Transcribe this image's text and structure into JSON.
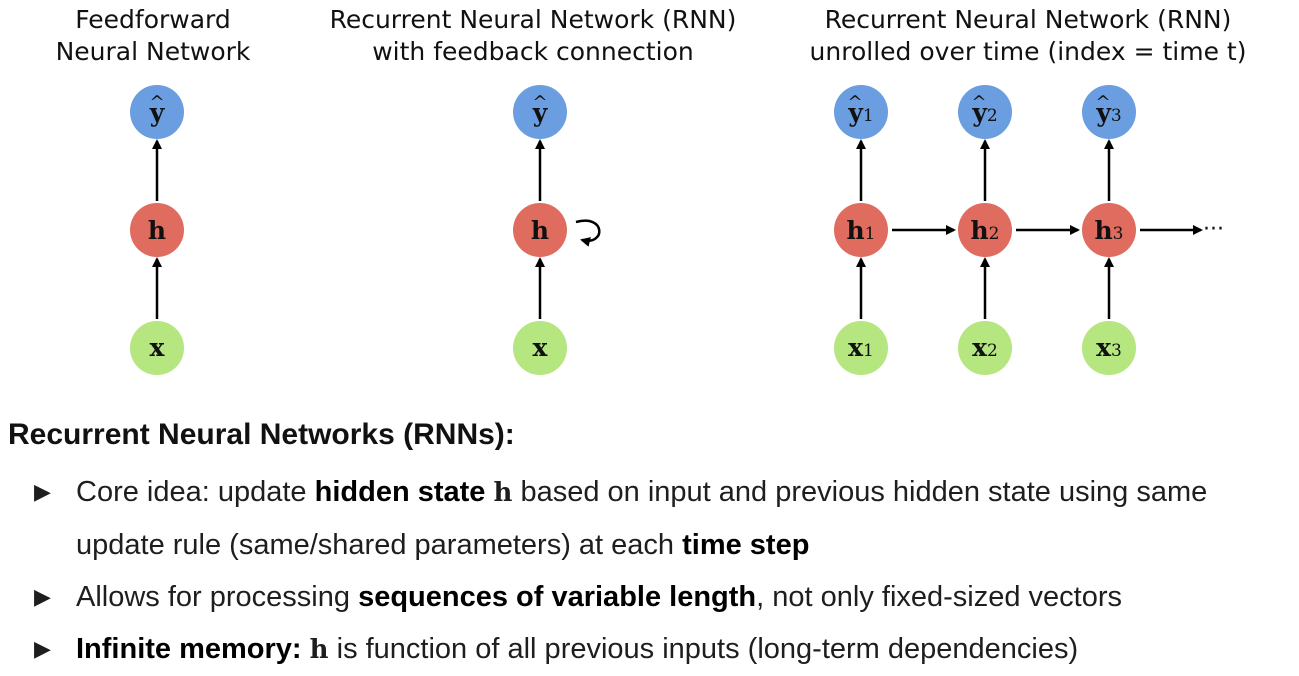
{
  "panels": [
    {
      "title_lines": [
        "Feedforward",
        "Neural Network"
      ]
    },
    {
      "title_lines": [
        "Recurrent Neural Network (RNN)",
        "with feedback connection"
      ]
    },
    {
      "title_lines": [
        "Recurrent Neural Network (RNN)",
        "unrolled over time (index = time t)"
      ]
    }
  ],
  "nodes": {
    "output": {
      "label": "y",
      "color": "#6a9ee0"
    },
    "hidden": {
      "label": "h",
      "color": "#e06c5f"
    },
    "input": {
      "label": "x",
      "color": "#b5e67f"
    }
  },
  "unrolled_indices": [
    "1",
    "2",
    "3"
  ],
  "continuation": "···",
  "section": {
    "heading": "Recurrent Neural Networks (RNNs):",
    "bullets": [
      {
        "parts": [
          {
            "text": "Core idea: update "
          },
          {
            "text": "hidden state",
            "bold": true
          },
          {
            "text": " "
          },
          {
            "text": "h",
            "math": true
          },
          {
            "text": " based on input and previous hidden state using same update rule (same/shared parameters) at each "
          },
          {
            "text": "time step",
            "bold": true
          }
        ]
      },
      {
        "parts": [
          {
            "text": "Allows for processing "
          },
          {
            "text": "sequences of variable length",
            "bold": true
          },
          {
            "text": ", not only fixed-sized vectors"
          }
        ]
      },
      {
        "parts": [
          {
            "text": "Infinite memory:",
            "bold": true
          },
          {
            "text": " "
          },
          {
            "text": "h",
            "math": true
          },
          {
            "text": " is function of all previous inputs (long-term dependencies)"
          }
        ]
      }
    ]
  }
}
